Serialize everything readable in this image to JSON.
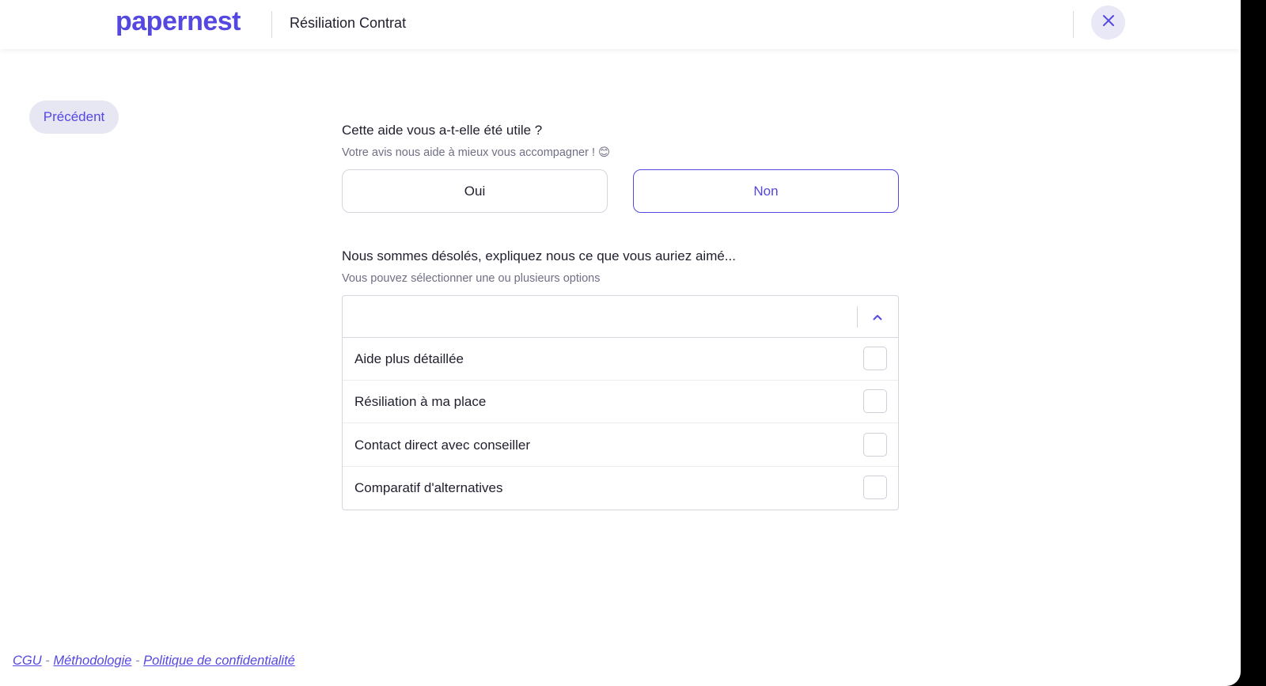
{
  "header": {
    "logo_text": "papernest",
    "title": "Résiliation Contrat",
    "close_icon": "close-icon"
  },
  "nav": {
    "previous_label": "Précédent"
  },
  "question1": {
    "title": "Cette aide vous a-t-elle été utile ?",
    "subtitle": "Votre avis nous aide à mieux vous accompagner ! 😊",
    "options": [
      {
        "label": "Oui",
        "selected": false
      },
      {
        "label": "Non",
        "selected": true
      }
    ]
  },
  "question2": {
    "title": "Nous sommes désolés, expliquez nous ce que vous auriez aimé...",
    "subtitle": "Vous pouvez sélectionner une ou plusieurs options",
    "dropdown_icon": "chevron-up-icon",
    "selected_value": "",
    "options": [
      {
        "label": "Aide plus détaillée",
        "checked": false
      },
      {
        "label": "Résiliation à ma place",
        "checked": false
      },
      {
        "label": "Contact direct avec conseiller",
        "checked": false
      },
      {
        "label": "Comparatif d'alternatives",
        "checked": false
      }
    ]
  },
  "footer": {
    "links": [
      "CGU",
      "Méthodologie",
      "Politique de confidentialité"
    ],
    "separator": "-"
  },
  "colors": {
    "accent": "#5548e0",
    "accent_light": "#e7e7f4",
    "border": "#d5d5de",
    "text": "#1f1f2e",
    "muted": "#6f6f85"
  }
}
